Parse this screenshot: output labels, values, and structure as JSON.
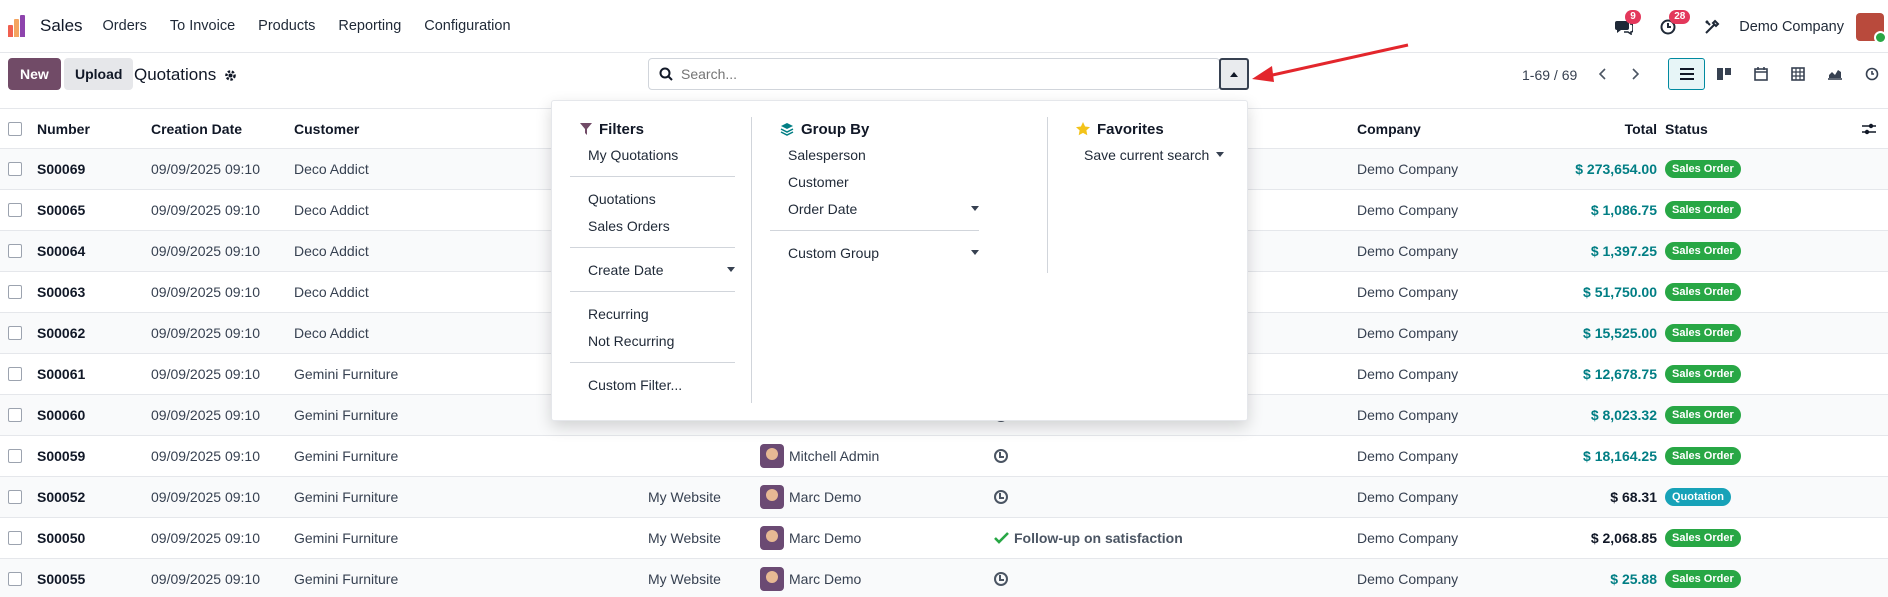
{
  "app": {
    "name": "Sales"
  },
  "nav": {
    "items": [
      "Orders",
      "To Invoice",
      "Products",
      "Reporting",
      "Configuration"
    ]
  },
  "systray": {
    "messages_badge": "9",
    "activities_badge": "28",
    "company": "Demo Company"
  },
  "toolbar": {
    "new_label": "New",
    "upload_label": "Upload",
    "breadcrumb": "Quotations"
  },
  "search": {
    "placeholder": "Search..."
  },
  "pager": {
    "text": "1-69 / 69"
  },
  "views": [
    "list-icon",
    "kanban-icon",
    "calendar-icon",
    "pivot-icon",
    "graph-icon",
    "activity-icon"
  ],
  "table": {
    "headers": {
      "number": "Number",
      "creation_date": "Creation Date",
      "customer": "Customer",
      "company": "Company",
      "total": "Total",
      "status": "Status"
    },
    "rows": [
      {
        "number": "S00069",
        "date": "09/09/2025 09:10",
        "customer": "Deco Addict",
        "website": "",
        "salesperson": "",
        "activity": "",
        "company": "Demo Company",
        "total": "$ 273,654.00",
        "total_style": "teal",
        "status": "Sales Order"
      },
      {
        "number": "S00065",
        "date": "09/09/2025 09:10",
        "customer": "Deco Addict",
        "website": "",
        "salesperson": "",
        "activity": "",
        "company": "Demo Company",
        "total": "$ 1,086.75",
        "total_style": "teal",
        "status": "Sales Order"
      },
      {
        "number": "S00064",
        "date": "09/09/2025 09:10",
        "customer": "Deco Addict",
        "website": "",
        "salesperson": "",
        "activity": "",
        "company": "Demo Company",
        "total": "$ 1,397.25",
        "total_style": "teal",
        "status": "Sales Order"
      },
      {
        "number": "S00063",
        "date": "09/09/2025 09:10",
        "customer": "Deco Addict",
        "website": "",
        "salesperson": "",
        "activity": "",
        "company": "Demo Company",
        "total": "$ 51,750.00",
        "total_style": "teal",
        "status": "Sales Order"
      },
      {
        "number": "S00062",
        "date": "09/09/2025 09:10",
        "customer": "Deco Addict",
        "website": "",
        "salesperson": "",
        "activity": "",
        "company": "Demo Company",
        "total": "$ 15,525.00",
        "total_style": "teal",
        "status": "Sales Order"
      },
      {
        "number": "S00061",
        "date": "09/09/2025 09:10",
        "customer": "Gemini Furniture",
        "website": "",
        "salesperson": "",
        "activity": "",
        "company": "Demo Company",
        "total": "$ 12,678.75",
        "total_style": "teal",
        "status": "Sales Order"
      },
      {
        "number": "S00060",
        "date": "09/09/2025 09:10",
        "customer": "Gemini Furniture",
        "website": "",
        "salesperson": "",
        "activity": "",
        "company": "Demo Company",
        "total": "$ 8,023.32",
        "total_style": "teal",
        "status": "Sales Order"
      },
      {
        "number": "S00059",
        "date": "09/09/2025 09:10",
        "customer": "Gemini Furniture",
        "website": "",
        "salesperson": "Mitchell Admin",
        "activity": "",
        "company": "Demo Company",
        "total": "$ 18,164.25",
        "total_style": "teal",
        "status": "Sales Order"
      },
      {
        "number": "S00052",
        "date": "09/09/2025 09:10",
        "customer": "Gemini Furniture",
        "website": "My Website",
        "salesperson": "Marc Demo",
        "activity": "",
        "company": "Demo Company",
        "total": "$ 68.31",
        "total_style": "dark",
        "status": "Quotation"
      },
      {
        "number": "S00050",
        "date": "09/09/2025 09:10",
        "customer": "Gemini Furniture",
        "website": "My Website",
        "salesperson": "Marc Demo",
        "activity": "Follow-up on satisfaction",
        "company": "Demo Company",
        "total": "$ 2,068.85",
        "total_style": "dark",
        "status": "Sales Order"
      },
      {
        "number": "S00055",
        "date": "09/09/2025 09:10",
        "customer": "Gemini Furniture",
        "website": "My Website",
        "salesperson": "Marc Demo",
        "activity": "",
        "company": "Demo Company",
        "total": "$ 25.88",
        "total_style": "teal",
        "status": "Sales Order"
      }
    ]
  },
  "dropdown": {
    "filters": {
      "title": "Filters",
      "items": [
        "My Quotations",
        "Quotations",
        "Sales Orders",
        "Create Date",
        "Recurring",
        "Not Recurring",
        "Custom Filter..."
      ]
    },
    "groupby": {
      "title": "Group By",
      "items": [
        "Salesperson",
        "Customer",
        "Order Date",
        "Custom Group"
      ]
    },
    "favorites": {
      "title": "Favorites",
      "items": [
        "Save current search"
      ]
    }
  },
  "colors": {
    "brand": "#714b67",
    "teal": "#017e84",
    "sales_order": "#28a745",
    "quotation": "#17a2b8",
    "arrow": "#e3262c"
  }
}
